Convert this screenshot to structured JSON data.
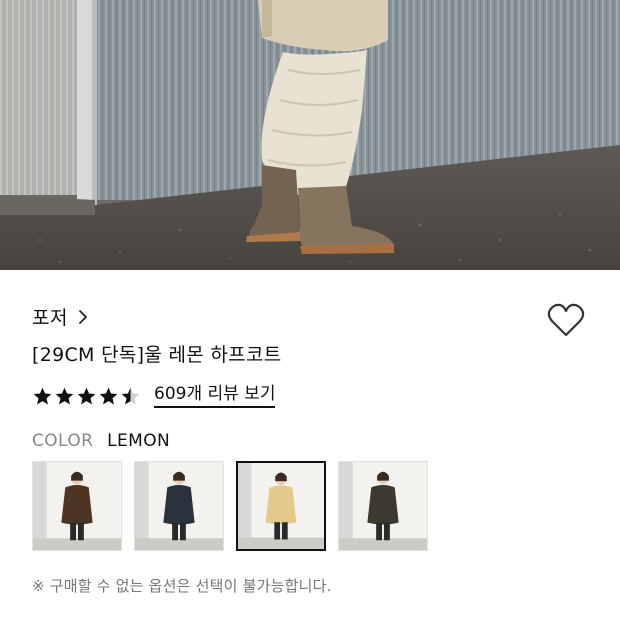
{
  "product": {
    "brand": "포저",
    "title": "[29CM 단독]울 레몬 하프코트",
    "rating": 4.5,
    "review_link": "609개 리뷰 보기",
    "color_label": "COLOR",
    "color_value": "LEMON",
    "notice": "※ 구매할 수 없는 옵션은 선택이 불가능합니다."
  },
  "icons": {
    "brand_chevron": "chevron-right-icon",
    "wishlist": "heart-outline-icon",
    "star": "star-icon"
  },
  "colors": {
    "star_fill": "#111111",
    "star_empty": "#cfcfcf",
    "selected_border": "#111111",
    "muted_text": "#888888"
  },
  "swatches": [
    {
      "name": "brown",
      "coat_color": "#4e3423",
      "selected": false
    },
    {
      "name": "navy",
      "coat_color": "#2b313d",
      "selected": false
    },
    {
      "name": "lemon",
      "coat_color": "#e3c98a",
      "selected": true
    },
    {
      "name": "khaki",
      "coat_color": "#3c3a30",
      "selected": false
    }
  ]
}
